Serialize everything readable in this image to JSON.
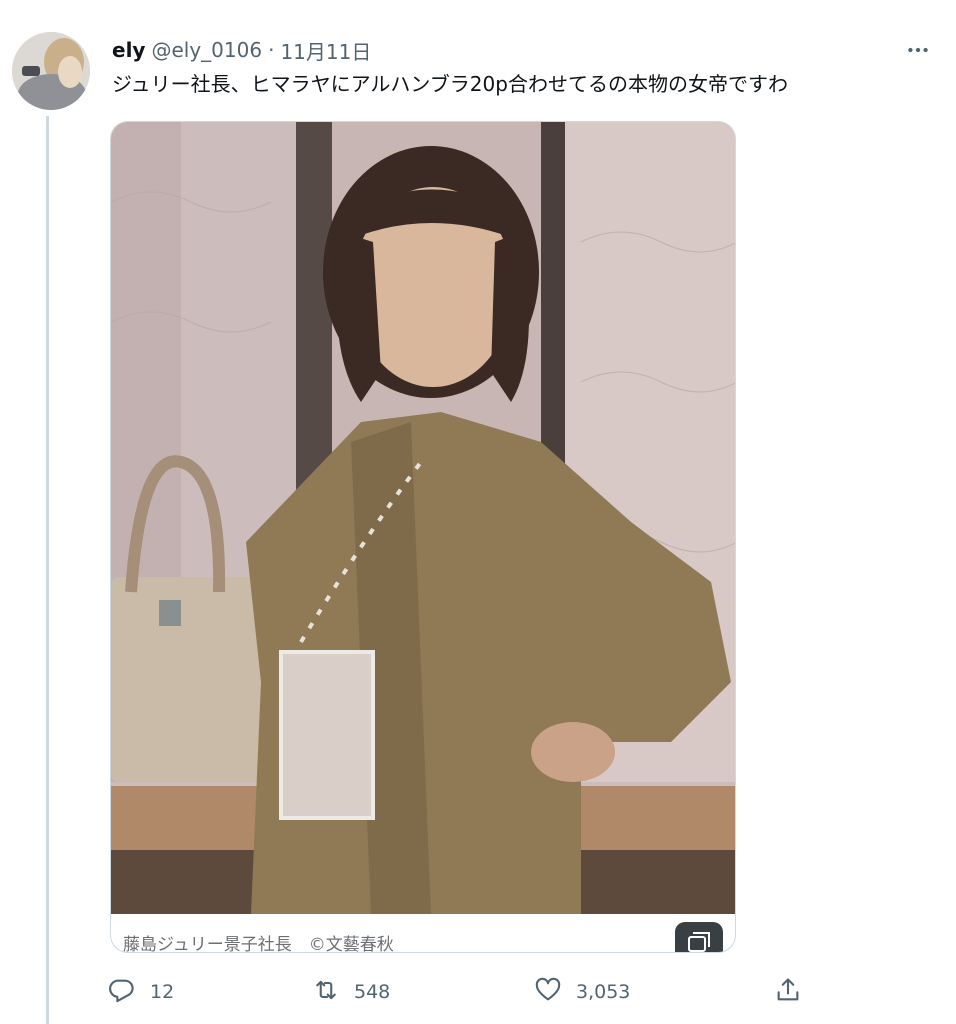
{
  "tweet": {
    "display_name": "ely",
    "handle": "@ely_0106",
    "separator": "·",
    "date": "11月11日",
    "text": "ジュリー社長、ヒマラヤにアルハンブラ20p合わせてるの本物の女帝ですわ",
    "more_icon": "more-horizontal-icon"
  },
  "media": {
    "caption": "藤島ジュリー景子社長　©文藝春秋",
    "gallery_icon": "gallery-icon"
  },
  "actions": {
    "reply": {
      "icon": "reply-icon",
      "count": "12"
    },
    "retweet": {
      "icon": "retweet-icon",
      "count": "548"
    },
    "like": {
      "icon": "heart-icon",
      "count": "3,053"
    },
    "share": {
      "icon": "share-icon"
    }
  },
  "colors": {
    "text_primary": "#0f1419",
    "text_secondary": "#536471",
    "border": "#cfd9de"
  }
}
